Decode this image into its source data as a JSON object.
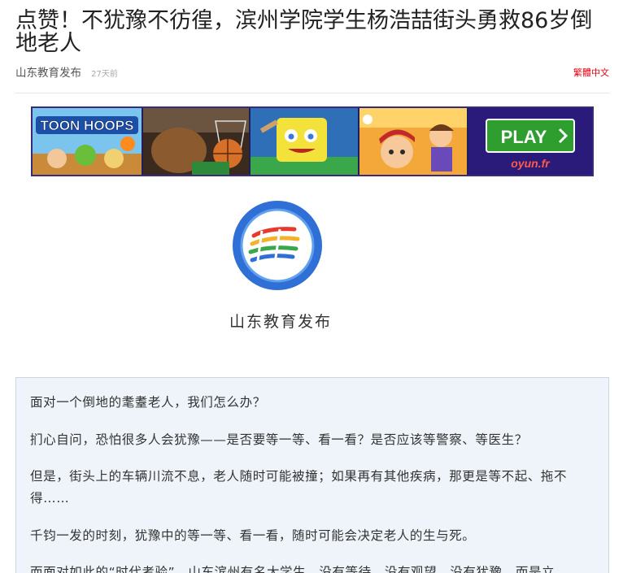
{
  "article": {
    "title": "点赞！不犹豫不彷徨，滨州学院学生杨浩喆街头勇救86岁倒地老人",
    "author": "山东教育发布",
    "time": "27天前",
    "traditional_label": "繁體中文"
  },
  "banner_ad": {
    "brand": "oyun.fr",
    "play_label": "PLAY",
    "tile1_text": "TOON HOOPS",
    "colors": {
      "background": "#1f1f5e",
      "play_button": "#2e9e2e",
      "play_border": "#ffffff"
    }
  },
  "logo": {
    "caption": "山东教育发布",
    "colors": {
      "ring": "#2f6fd6",
      "inner": "#ffffff"
    }
  },
  "body_paragraphs": [
    "面对一个倒地的耄耋老人，我们怎么办？",
    "扪心自问，恐怕很多人会犹豫——是否要等一等、看一看？是否应该等警察、等医生？",
    "但是，街头上的车辆川流不息，老人随时可能被撞；如果再有其他疾病，那更是等不起、拖不得……",
    "千钧一发的时刻，犹豫中的等一等、看一看，随时可能会决定老人的生与死。",
    "而面对如此的“时代考验”，山东滨州有名大学生，没有等待，没有观望，没有犹豫，而是立"
  ]
}
